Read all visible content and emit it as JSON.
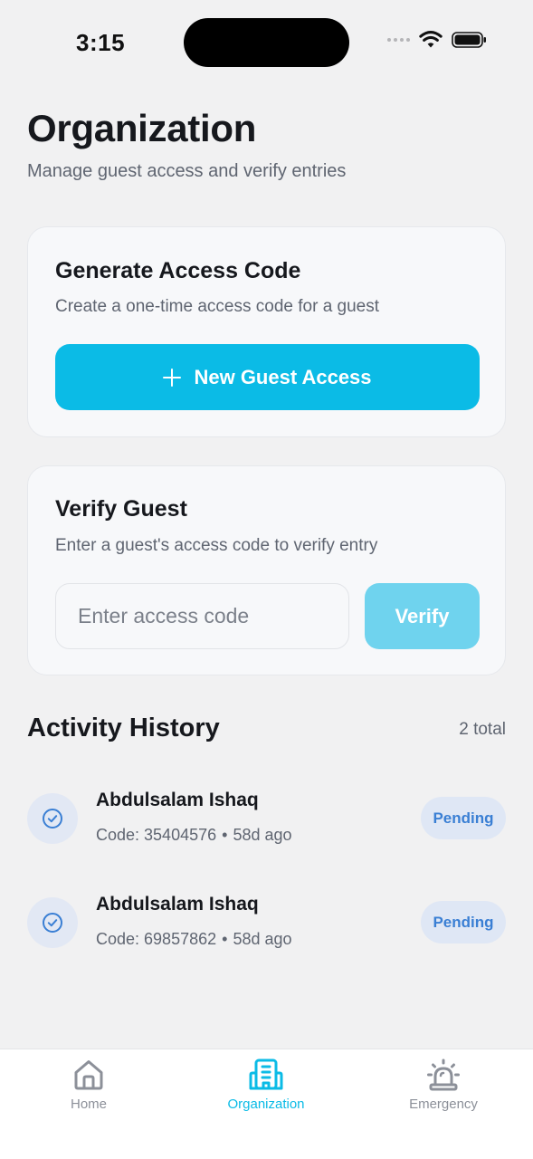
{
  "status_bar": {
    "time": "3:15"
  },
  "header": {
    "title": "Organization",
    "subtitle": "Manage guest access and verify entries"
  },
  "generate_card": {
    "title": "Generate Access Code",
    "description": "Create a one-time access code for a guest",
    "button_label": "New Guest Access",
    "button_icon": "plus-icon"
  },
  "verify_card": {
    "title": "Verify Guest",
    "description": "Enter a guest's access code to verify entry",
    "input_value": "",
    "input_placeholder": "Enter access code",
    "button_label": "Verify"
  },
  "activity": {
    "title": "Activity History",
    "count_label": "2 total",
    "items": [
      {
        "name": "Abdulsalam Ishaq",
        "code": "Code: 35404576",
        "separator": "•",
        "time": "58d ago",
        "status": "Pending",
        "icon": "check-circle-icon"
      },
      {
        "name": "Abdulsalam Ishaq",
        "code": "Code: 69857862",
        "separator": "•",
        "time": "58d ago",
        "status": "Pending",
        "icon": "check-circle-icon"
      }
    ]
  },
  "tab_bar": {
    "active": "Organization",
    "tabs": [
      {
        "label": "Home",
        "icon": "home-icon"
      },
      {
        "label": "Organization",
        "icon": "building-icon"
      },
      {
        "label": "Emergency",
        "icon": "siren-icon"
      }
    ]
  },
  "colors": {
    "accent": "#0bbbe6",
    "accent_disabled": "#6fd3ee",
    "badge_bg": "#dfe7f5",
    "badge_text": "#3a7fd4",
    "background": "#f1f1f2"
  }
}
